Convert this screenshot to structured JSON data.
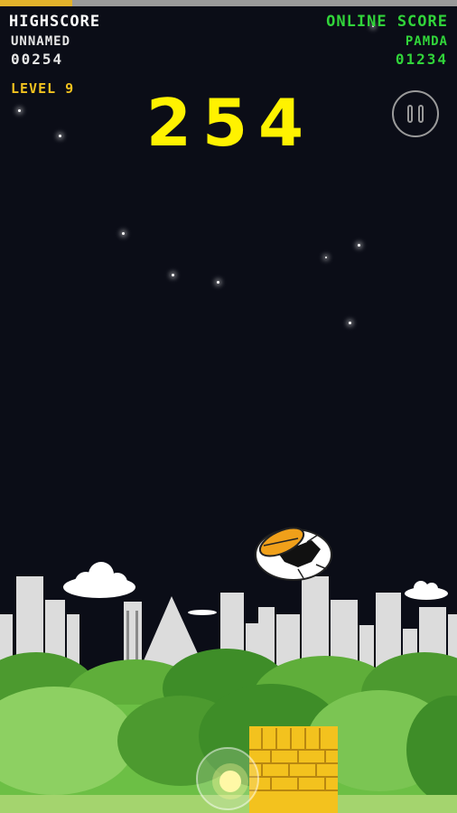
{
  "hud": {
    "highscore_title": "HIGHSCORE",
    "highscore_name": "UNNAMED",
    "highscore_value": "00254",
    "level_label": "LEVEL 9",
    "online_title": "ONLINE SCORE",
    "online_name": "PAMDA",
    "online_value": "01234",
    "current_score": "254"
  },
  "colors": {
    "sky": "#0b0d17",
    "score_yellow": "#fff200",
    "online_green": "#31d43a",
    "level_gold": "#f2c21f",
    "brick": "#f3c21e"
  },
  "icons": {
    "pause": "pause-icon",
    "player": "hatching-egg-bird",
    "tower": "brick-tower",
    "bubble": "glowing-bubble"
  }
}
